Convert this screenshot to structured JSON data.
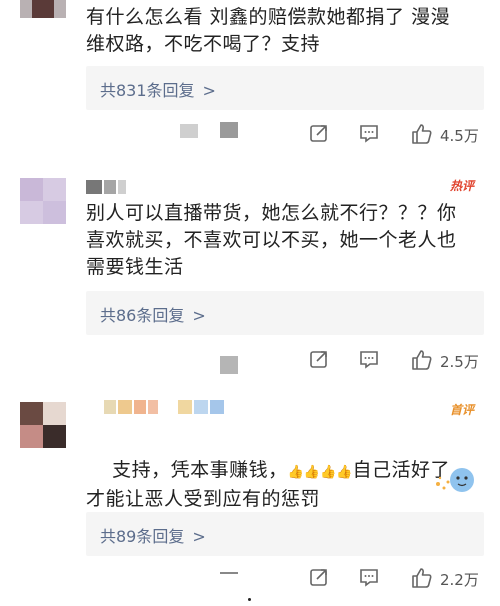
{
  "comments": [
    {
      "text": "有什么怎么看 刘鑫的赔偿款她都捐了 漫漫\n维权路，不吃不喝了？支持",
      "reply_label": "共831条回复",
      "reply_chevron": ">",
      "likes": "4.5万"
    },
    {
      "badge": "热评",
      "text": "别人可以直播带货，她怎么就不行？？？你\n喜欢就买，不喜欢可以不买，她一个老人也\n需要钱生活",
      "reply_label": "共86条回复",
      "reply_chevron": ">",
      "likes": "2.5万"
    },
    {
      "badge": "首评",
      "text_a": "支持，凭本事赚钱，",
      "thumbs": "👍👍👍👍",
      "text_b": "自己活好了",
      "text_c": "才能让恶人受到应有的惩罚",
      "reply_label": "共89条回复",
      "reply_chevron": ">",
      "likes": "2.2万"
    }
  ],
  "colors": {
    "link": "#5c6d8c",
    "hot_badge": "#e0442f",
    "first_badge": "#e8902a",
    "reply_bg": "#f5f5f5"
  },
  "icons": [
    "share-icon",
    "comment-icon",
    "like-icon"
  ]
}
